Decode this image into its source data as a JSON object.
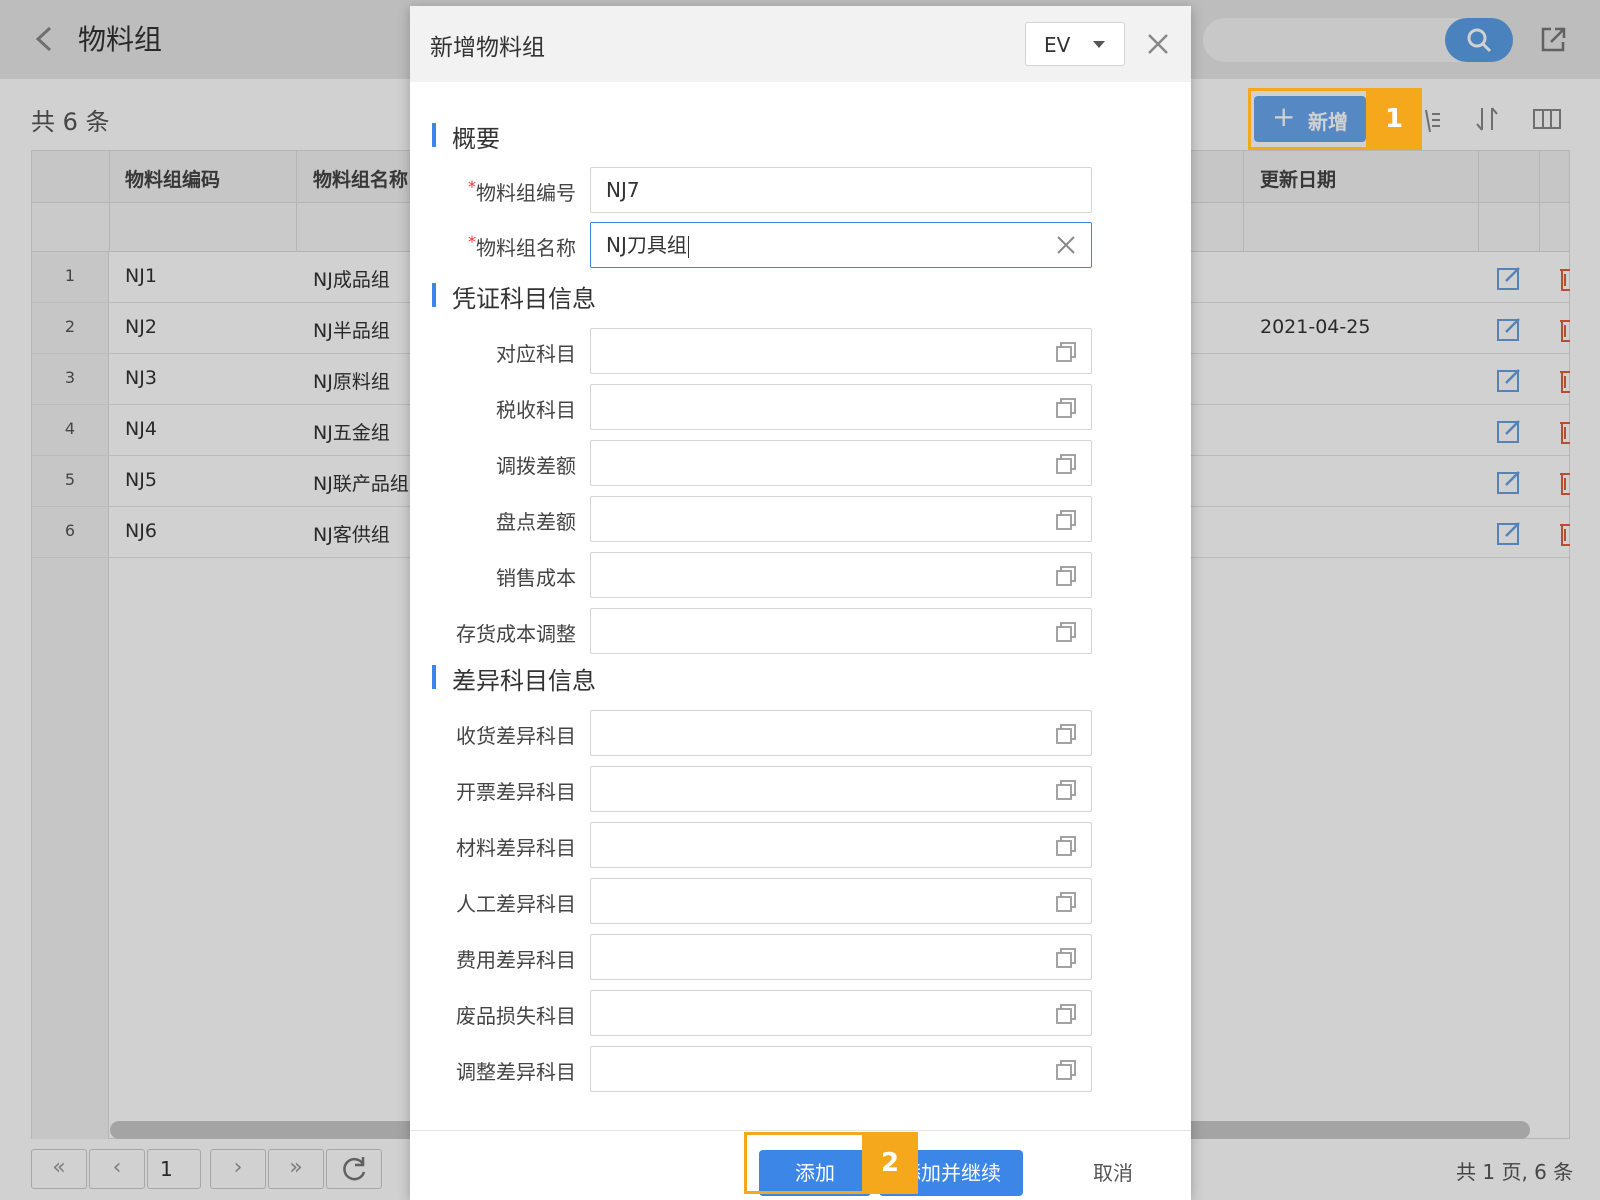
{
  "page": {
    "title": "物料组",
    "count_text": "共 6 条",
    "add_button_label": "新增"
  },
  "table": {
    "columns": [
      "物料组编码",
      "物料组名称",
      "更新日期"
    ],
    "rows": [
      {
        "index": "1",
        "code": "NJ1",
        "name": "NJ成品组",
        "date": ""
      },
      {
        "index": "2",
        "code": "NJ2",
        "name": "NJ半品组",
        "date": "2021-04-25"
      },
      {
        "index": "3",
        "code": "NJ3",
        "name": "NJ原料组",
        "date": ""
      },
      {
        "index": "4",
        "code": "NJ4",
        "name": "NJ五金组",
        "date": ""
      },
      {
        "index": "5",
        "code": "NJ5",
        "name": "NJ联产品组",
        "date": ""
      },
      {
        "index": "6",
        "code": "NJ6",
        "name": "NJ客供组",
        "date": ""
      }
    ]
  },
  "pager": {
    "first": "«",
    "prev": "‹",
    "page": "1",
    "next": "›",
    "last": "»",
    "summary": "共 1 页, 6 条"
  },
  "dialog": {
    "title": "新增物料组",
    "language": "EV",
    "sections": {
      "overview": "概要",
      "voucher": "凭证科目信息",
      "variance": "差异科目信息"
    },
    "required_mark": "*",
    "fields": {
      "code_label": "物料组编号",
      "code_value": "NJ7",
      "name_label": "物料组名称",
      "name_value": "NJ刀具组"
    },
    "voucher_fields": [
      "对应科目",
      "税收科目",
      "调拨差额",
      "盘点差额",
      "销售成本",
      "存货成本调整"
    ],
    "variance_fields": [
      "收货差异科目",
      "开票差异科目",
      "材料差异科目",
      "人工差异科目",
      "费用差异科目",
      "废品损失科目",
      "调整差异科目"
    ],
    "buttons": {
      "add": "添加",
      "add_continue": "添加并继续",
      "cancel": "取消"
    }
  },
  "callouts": [
    "1",
    "2"
  ],
  "colors": {
    "primary": "#3b86e6",
    "callout": "#f5a81c",
    "delete": "#e0603c"
  }
}
